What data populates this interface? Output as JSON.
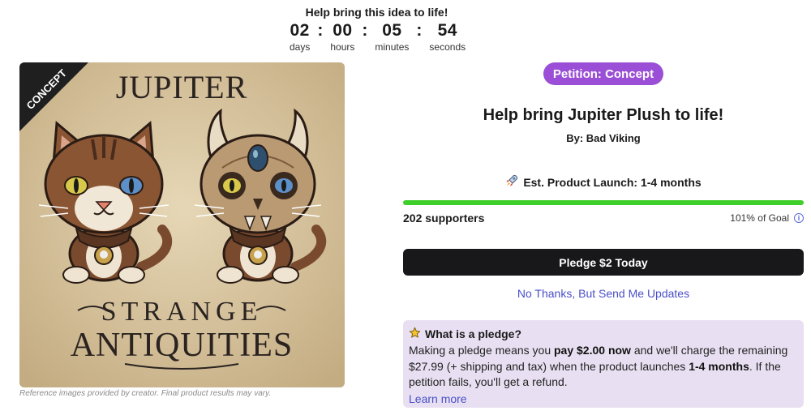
{
  "countdown": {
    "heading": "Help bring this idea to life!",
    "days": "02",
    "days_label": "days",
    "hours": "00",
    "hours_label": "hours",
    "minutes": "05",
    "minutes_label": "minutes",
    "seconds": "54",
    "seconds_label": "seconds",
    "separator": ":"
  },
  "product_image": {
    "ribbon": "CONCEPT",
    "top_text": "JUPITER",
    "bottom_line1": "STRANGE",
    "bottom_line2": "ANTIQUITIES",
    "disclaimer": "Reference images provided by creator. Final product results may vary."
  },
  "campaign": {
    "badge": "Petition: Concept",
    "title": "Help bring Jupiter Plush to life!",
    "byline": "By: Bad Viking",
    "launch_icon": "rocket-icon",
    "launch_text": "Est. Product Launch: 1-4 months",
    "progress_fraction": 1.0,
    "supporters": "202 supporters",
    "goal": "101% of Goal",
    "pledge_button": "Pledge $2 Today",
    "updates_link": "No Thanks, But Send Me Updates"
  },
  "pledge_info": {
    "icon": "star-icon",
    "title": "What is a pledge?",
    "t1": "Making a pledge means you ",
    "b1": "pay $2.00 now",
    "t2": " and we'll charge the remaining $27.99 (+ shipping and tax) when the product launches ",
    "b2": "1-4 months",
    "t3": ". If the petition fails, you'll get a refund.",
    "learn_more": "Learn more"
  },
  "colors": {
    "badge": "#9a4fd6",
    "progress": "#3ecf2a",
    "button": "#18181b",
    "link": "#4a4fc7",
    "info_bg": "#e8e0f2"
  }
}
